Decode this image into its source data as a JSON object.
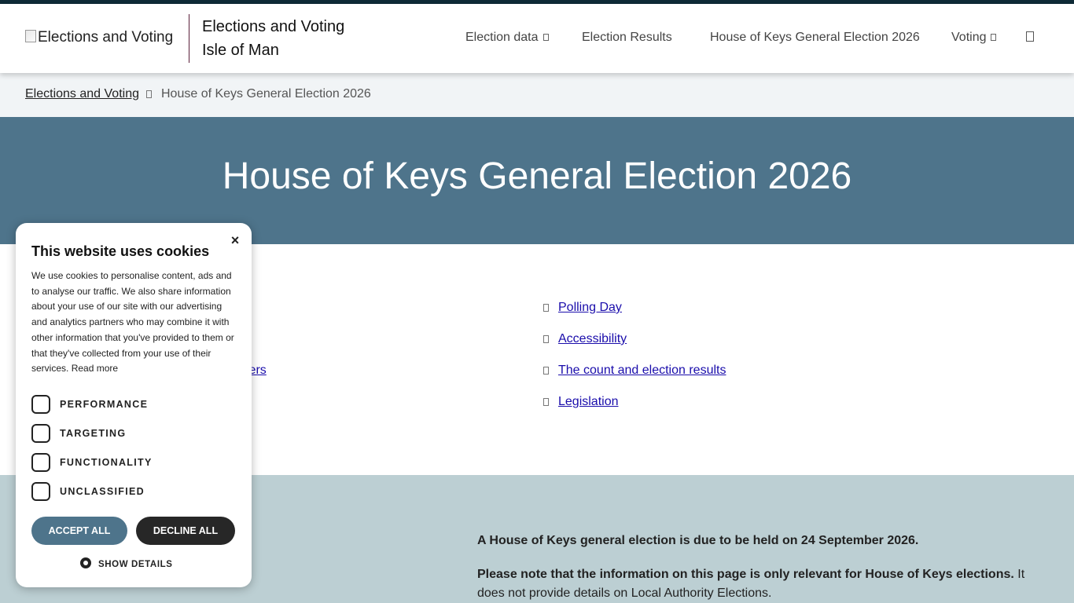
{
  "header": {
    "logo_alt": "Elections and Voting",
    "site_title_line1": "Elections and Voting",
    "site_title_line2": "Isle of Man",
    "nav": {
      "election_data": "Election data",
      "election_results": "Election Results",
      "general_election": "House of Keys General Election 2026",
      "voting": "Voting"
    },
    "search_icon": "search-icon"
  },
  "breadcrumb": {
    "home": "Elections and Voting",
    "current": "House of Keys General Election 2026"
  },
  "hero": {
    "title": "House of Keys General Election 2026"
  },
  "links": {
    "left_partial": "icers",
    "right": [
      "Polling Day",
      "Accessibility",
      "The count and election results",
      "Legislation"
    ]
  },
  "info": {
    "p1": "A House of Keys general election is due to be held on 24 September 2026.",
    "p2_bold": "Please note that the information on this page is only relevant for House of Keys elections.",
    "p2_rest": " It does not provide details on Local Authority Elections."
  },
  "cookie": {
    "title": "This website uses cookies",
    "body": "We use cookies to personalise content, ads and to analyse our traffic. We also share information about your use of our site with our advertising and analytics partners who may combine it with other information that you've provided to them or that they've collected from your use of their services.",
    "read_more": "Read more",
    "options": [
      "PERFORMANCE",
      "TARGETING",
      "FUNCTIONALITY",
      "UNCLASSIFIED"
    ],
    "accept": "ACCEPT ALL",
    "decline": "DECLINE ALL",
    "show_details": "SHOW DETAILS",
    "close": "×"
  },
  "colors": {
    "hero_bg": "#4e748b",
    "info_bg": "#bccfd3",
    "breadcrumb_bg": "#f1f4f6",
    "decline_bg": "#272727",
    "link": "#1a0dab"
  }
}
